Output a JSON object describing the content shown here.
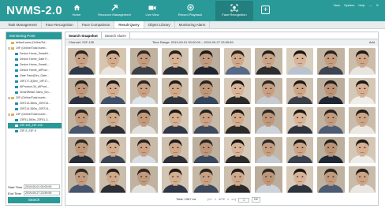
{
  "app": {
    "title": "NVMS-2.0"
  },
  "nav": [
    {
      "label": "Home",
      "icon": "home-icon"
    },
    {
      "label": "Resource Management",
      "icon": "tools-icon"
    },
    {
      "label": "Live View",
      "icon": "camera-icon"
    },
    {
      "label": "Record Playback",
      "icon": "playback-icon"
    },
    {
      "label": "Face Recognition",
      "icon": "face-scan-icon"
    }
  ],
  "topright": {
    "view": "View",
    "system": "System",
    "help": "Help"
  },
  "tabs": [
    "Task Management",
    "Face Recognition",
    "Face Comparison",
    "Result Query",
    "Object Library",
    "Monitoring Alarm"
  ],
  "active_tab": "Result Query",
  "left": {
    "header": "Monitoring Point",
    "tree": [
      {
        "label": "default area (Online/Tot...",
        "level": 1,
        "icon": "folder",
        "toggle": ""
      },
      {
        "label": "19F (Online/Total numb...",
        "level": 1,
        "icon": "folder",
        "toggle": "⊟"
      },
      {
        "label": "Device Home_SmartN...",
        "level": 2,
        "icon": "cam",
        "toggle": ""
      },
      {
        "label": "Device Home_Gate F...",
        "level": 2,
        "icon": "cam",
        "toggle": ""
      },
      {
        "label": "Device Home_SmartL...",
        "level": 2,
        "icon": "cam",
        "toggle": ""
      },
      {
        "label": "Device Home_AIProd...",
        "level": 2,
        "icon": "cam",
        "toggle": ""
      },
      {
        "label": "Gate Face(Dev_Gate...",
        "level": 2,
        "icon": "cam",
        "toggle": ""
      },
      {
        "label": "19F177-3(Dev_19F17...",
        "level": 2,
        "icon": "cam",
        "toggle": ""
      },
      {
        "label": "AIProduct-34_AIProd...",
        "level": 2,
        "icon": "cam",
        "toggle": ""
      },
      {
        "label": "SmartRetail-Twins_Sm...",
        "level": 2,
        "icon": "cam",
        "toggle": ""
      },
      {
        "label": "20F (Online/Total numb...",
        "level": 1,
        "icon": "folder",
        "toggle": "⊟"
      },
      {
        "label": "20F213-360w_20F213...",
        "level": 2,
        "icon": "cam",
        "toggle": ""
      },
      {
        "label": "20F214-360w_20F214...",
        "level": 2,
        "icon": "cam",
        "toggle": ""
      },
      {
        "label": "23F (Online/Total numb...",
        "level": 1,
        "icon": "folder",
        "toggle": "⊟"
      },
      {
        "label": "23F51-360w_23F51-3...",
        "level": 2,
        "icon": "cam",
        "toggle": ""
      },
      {
        "label": "23F-105_23F-105",
        "level": 2,
        "icon": "cam",
        "toggle": "",
        "selected": true
      },
      {
        "label": "23F-9_23F-9",
        "level": 2,
        "icon": "cam",
        "toggle": ""
      }
    ],
    "start_label": "Start Time",
    "start_value": "2019-09-01 00:00:00",
    "end_label": "End Time",
    "end_value": "2019-09-27 23:59:59",
    "search_label": "Search"
  },
  "right": {
    "subtabs": [
      "Search Snapshot",
      "Search Alarm"
    ],
    "active_subtab": "Search Snapshot",
    "channel": "Channel: 23F-105",
    "time_range": "Time Range: 2019-09-01 00:00:00 – 2019-09-27 23:59:59",
    "add": "Add",
    "pager": {
      "total": "Total: 1967 ea",
      "first": "|<<",
      "prev": "<",
      "page": "1/72",
      "next": ">",
      "last": ">>|",
      "input": "1",
      "ok": "OK"
    }
  },
  "faces": [
    {
      "bg": "#c9b9a6",
      "skin": "#c8a184",
      "hair": "#2a2420",
      "shirt": "#2e3a4a"
    },
    {
      "bg": "#d6c6b0",
      "skin": "#d2ab8d",
      "hair": "#1f1a17",
      "shirt": "#eae6df"
    },
    {
      "bg": "#c0b2a0",
      "skin": "#c29b7d",
      "hair": "#2d2622",
      "shirt": "#3b3f46"
    },
    {
      "bg": "#cfc3b1",
      "skin": "#d6b194",
      "hair": "#241e1b",
      "shirt": "#2a2f38"
    },
    {
      "bg": "#b9ad9d",
      "skin": "#c09a7e",
      "hair": "#1d1917",
      "shirt": "#1f2530"
    },
    {
      "bg": "#d4c7b6",
      "skin": "#cfa889",
      "hair": "#2b2420",
      "shirt": "#556a86"
    },
    {
      "bg": "#c5b8a6",
      "skin": "#caa386",
      "hair": "#221d1a",
      "shirt": "#2d2d2d"
    },
    {
      "bg": "#d9cdbd",
      "skin": "#d9b69b",
      "hair": "#1a1614",
      "shirt": "#b9c3cf"
    },
    {
      "bg": "#c2b4a2",
      "skin": "#c49d80",
      "hair": "#2a231f",
      "shirt": "#3d4452"
    },
    {
      "bg": "#cbbdaa",
      "skin": "#cda78a",
      "hair": "#1e1a17",
      "shirt": "#e8e5e0"
    },
    {
      "bg": "#bfb2a1",
      "skin": "#bf987b",
      "hair": "#27211d",
      "shirt": "#2b3140"
    },
    {
      "bg": "#d2c5b3",
      "skin": "#d3ad90",
      "hair": "#1c1815",
      "shirt": "#41506a"
    },
    {
      "bg": "#c7baa8",
      "skin": "#c8a083",
      "hair": "#2c2521",
      "shirt": "#dfe4ea"
    },
    {
      "bg": "#cdbfad",
      "skin": "#d0a98b",
      "hair": "#201b18",
      "shirt": "#2f343c"
    },
    {
      "bg": "#bdb09f",
      "skin": "#bd9679",
      "hair": "#29221e",
      "shirt": "#34455e"
    },
    {
      "bg": "#d7cab9",
      "skin": "#d7b397",
      "hair": "#1b1714",
      "shirt": "#2a2a2a"
    },
    {
      "bg": "#c4b6a4",
      "skin": "#c69f82",
      "hair": "#2e2723",
      "shirt": "#c7ccd3"
    },
    {
      "bg": "#d0c2b0",
      "skin": "#cda688",
      "hair": "#1f1a17",
      "shirt": "#3a3f49"
    },
    {
      "bg": "#bbae9d",
      "skin": "#bb9477",
      "hair": "#25201c",
      "shirt": "#1e2633"
    },
    {
      "bg": "#d5c8b7",
      "skin": "#d5b093",
      "hair": "#1d1916",
      "shirt": "#f0eeea"
    },
    {
      "bg": "#c3b5a3",
      "skin": "#c39c7f",
      "hair": "#2a2420",
      "shirt": "#46566e"
    },
    {
      "bg": "#ccbeac",
      "skin": "#cfa98b",
      "hair": "#211c19",
      "shirt": "#2c2f35"
    },
    {
      "bg": "#c0b3a2",
      "skin": "#c19a7d",
      "hair": "#2b2420",
      "shirt": "#e2e0dc"
    },
    {
      "bg": "#d3c6b4",
      "skin": "#d4ae91",
      "hair": "#1c1815",
      "shirt": "#30384a"
    },
    {
      "bg": "#c6b9a7",
      "skin": "#c9a285",
      "hair": "#27211d",
      "shirt": "#3e4a5d"
    },
    {
      "bg": "#cec0ae",
      "skin": "#d1aa8c",
      "hair": "#1f1a17",
      "shirt": "#2b2b2b"
    },
    {
      "bg": "#bcae9d",
      "skin": "#be977a",
      "hair": "#2d2622",
      "shirt": "#cdd3da"
    },
    {
      "bg": "#d8cbba",
      "skin": "#d8b498",
      "hair": "#1a1614",
      "shirt": "#2e3540"
    },
    {
      "bg": "#c1b3a1",
      "skin": "#c29b7e",
      "hair": "#29231f",
      "shirt": "#4c5c75"
    },
    {
      "bg": "#cabcaa",
      "skin": "#cca587",
      "hair": "#211c19",
      "shirt": "#ebe8e3"
    },
    {
      "bg": "#beb1a0",
      "skin": "#bf987b",
      "hair": "#2c2521",
      "shirt": "#262c38"
    },
    {
      "bg": "#d1c4b2",
      "skin": "#d2ac8e",
      "hair": "#1e1a17",
      "shirt": "#3b4453"
    },
    {
      "bg": "#c8baa8",
      "skin": "#c9a184",
      "hair": "#28221e",
      "shirt": "#d9dee4"
    },
    {
      "bg": "#cfc1af",
      "skin": "#cea789",
      "hair": "#201b18",
      "shirt": "#2d3037"
    },
    {
      "bg": "#bdb09e",
      "skin": "#bc9578",
      "hair": "#2b2420",
      "shirt": "#37485f"
    },
    {
      "bg": "#d6c9b8",
      "skin": "#d6b296",
      "hair": "#1b1714",
      "shirt": "#2b2b2b"
    },
    {
      "bg": "#c3b6a4",
      "skin": "#c59e81",
      "hair": "#2e2723",
      "shirt": "#c4cad1"
    },
    {
      "bg": "#cdbfad",
      "skin": "#cca587",
      "hair": "#1f1a17",
      "shirt": "#394050"
    },
    {
      "bg": "#bbaf9e",
      "skin": "#ba9376",
      "hair": "#26201c",
      "shirt": "#1f2734"
    },
    {
      "bg": "#d4c7b6",
      "skin": "#d4af92",
      "hair": "#1c1815",
      "shirt": "#efede9"
    },
    {
      "bg": "#c2b4a2",
      "skin": "#c39c7f",
      "hair": "#2a2420",
      "shirt": "#45556d"
    },
    {
      "bg": "#cbbdab",
      "skin": "#cea88a",
      "hair": "#211c19",
      "shirt": "#2c2f35"
    },
    {
      "bg": "#bfb2a1",
      "skin": "#c0997c",
      "hair": "#2b2420",
      "shirt": "#e1dfdb"
    },
    {
      "bg": "#d2c5b3",
      "skin": "#d3ad90",
      "hair": "#1c1815",
      "shirt": "#2f3749"
    },
    {
      "bg": "#c5b8a6",
      "skin": "#c8a184",
      "hair": "#27211d",
      "shirt": "#3d495c"
    },
    {
      "bg": "#cdbfad",
      "skin": "#d0a98b",
      "hair": "#1f1a17",
      "shirt": "#2a2a2a"
    },
    {
      "bg": "#bbad9c",
      "skin": "#bd9679",
      "hair": "#2d2622",
      "shirt": "#ccd2d9"
    },
    {
      "bg": "#d7cab9",
      "skin": "#d7b397",
      "hair": "#1a1614",
      "shirt": "#2d343f"
    },
    {
      "bg": "#c0b2a0",
      "skin": "#c19a7d",
      "hair": "#29231f",
      "shirt": "#4b5b74"
    },
    {
      "bg": "#c9bba9",
      "skin": "#cba486",
      "hair": "#211c19",
      "shirt": "#eae7e2"
    }
  ]
}
